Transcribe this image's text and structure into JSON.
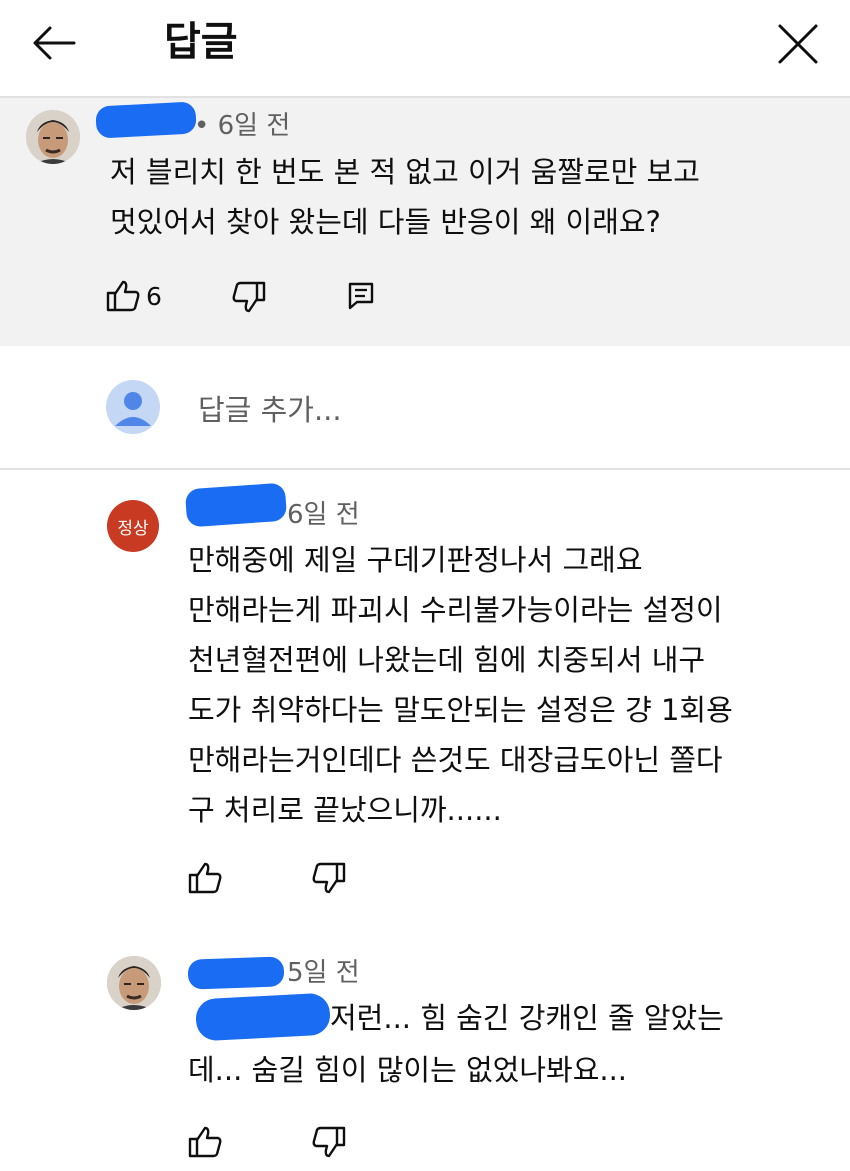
{
  "header": {
    "back_icon": "arrow-left-icon",
    "title": "답글",
    "close_icon": "close-icon"
  },
  "parent_comment": {
    "avatar": "user-photo-avatar",
    "time": "• 6일 전",
    "text_lines": [
      "저 블리치 한 번도 본 적 없고 이거 움짤로만 보고",
      "멋있어서 찾아 왔는데 다들 반응이 왜 이래요?"
    ],
    "like_count": "6",
    "icons": [
      "thumbs-up-icon",
      "thumbs-down-icon",
      "reply-icon"
    ]
  },
  "add_reply": {
    "avatar": "default-user-avatar",
    "placeholder": "답글 추가..."
  },
  "replies": [
    {
      "avatar_badge": "정상",
      "time": "6일 전",
      "text_lines": [
        "만해중에 제일 구데기판정나서 그래요",
        "만해라는게 파괴시 수리불가능이라는 설정이",
        "천년혈전편에 나왔는데 힘에 치중되서 내구",
        "도가 취약하다는 말도안되는 설정은 걍 1회용",
        "만해라는거인데다 쓴것도 대장급도아닌 쫄다",
        "구 처리로 끝났으니까......"
      ]
    },
    {
      "avatar": "user-photo-avatar",
      "time": "5일 전",
      "text_lines": [
        "저런... 힘 숨긴 강캐인 줄 알았는",
        "데... 숨길 힘이 많이는 없었나봐요..."
      ]
    }
  ],
  "colors": {
    "redaction_blue": "#1a6cf2",
    "badge_red": "#c93a23",
    "parent_bg": "#f2f2f2",
    "muted_text": "#606060"
  }
}
